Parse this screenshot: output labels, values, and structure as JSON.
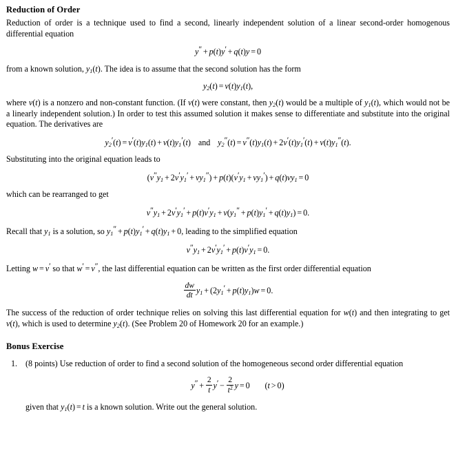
{
  "document": {
    "title": "Reduction of Order",
    "bonus_heading": "Bonus Exercise"
  },
  "paragraphs": {
    "intro": "Reduction of order is a technique used to find a second, linearly independent solution of a linear second-order homogenous differential equation",
    "from_known_pre": "from a known solution, ",
    "from_known_post": ". The idea is to assume that the second solution has the form",
    "where_v_1": "where ",
    "where_v_2": " is a nonzero and non-constant function. (If ",
    "where_v_3": " were constant, then ",
    "where_v_4": " would be a multiple of ",
    "where_v_5": ", which would not be a linearly independent solution.) In order to test this assumed solution it makes sense to differentiate and substitute into the original equation. The derivatives are",
    "substituting": "Substituting into the original equation leads to",
    "rearranged": "which can be rearranged to get",
    "recall_1": "Recall that ",
    "recall_2": " is a solution, so ",
    "recall_3": ", leading to the simplified equation",
    "letting_1": "Letting ",
    "letting_2": " so that ",
    "letting_3": ", the last differential equation can be written as the first order differential equation",
    "success_1": "The success of the reduction of order technique relies on solving this last differential equation for ",
    "success_2": " and then integrating to get ",
    "success_3": ", which is used to determine ",
    "success_4": ". (See Problem 20 of Homework 20 for an example.)"
  },
  "equations": {
    "ode_general": "y'' + p(t)y' + q(t)y = 0",
    "y2_form": "y_2(t) = v(t)y_1(t),",
    "derivatives": "y_2'(t) = v'(t)y_1(t) + v(t)y_1'(t)   and   y_2''(t) = v''(t)y_1(t) + 2v'(t)y_1'(t) + v(t)y_1''(t).",
    "substituted": "(v''y_1 + 2v'y_1' + vy_1'') + p(t)(v'y_1 + vy_1') + q(t)vy_1 = 0",
    "rearranged": "v''y_1 + 2v'y_1' + p(t)v'y_1 + v(y_1'' + p(t)y_1' + q(t)y_1) = 0.",
    "recall_inline": "y_1'' + p(t)y_1' + q(t)y_1 + 0",
    "simplified": "v''y_1 + 2v'y_1' + p(t)v'y_1 = 0.",
    "first_order": "dw/dt y_1 + (2y_1' + p(t)y_1)w = 0.",
    "exercise_ode": "y'' + (2/t)y' - (2/t^2)y = 0   (t > 0)"
  },
  "exercise": {
    "number": "1.",
    "points_label": "(8 points)",
    "statement": " Use reduction of order to find a second solution of the homogeneous second order differential equation",
    "given_1": "given that ",
    "given_2": " is a known solution. Write out the general solution.",
    "frac_two": "2",
    "denom_t": "t",
    "denom_t2": "t"
  },
  "symbols": {
    "y": "y",
    "v": "v",
    "t": "t",
    "w": "w",
    "p": "p",
    "q": "q",
    "d": "d",
    "zero": "0",
    "two": "2",
    "sub1": "1",
    "sub2": "2",
    "prime": "′",
    "dprime": "″",
    "plus": "+",
    "minus": "−",
    "equals": "=",
    "gt": ">",
    "and_word": "and"
  },
  "colors": {
    "page_background": "#ffffff",
    "text": "#000000"
  }
}
